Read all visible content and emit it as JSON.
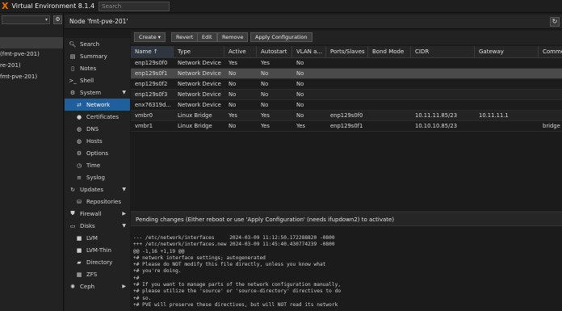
{
  "app": {
    "logo": "X",
    "title": "Virtual Environment 8.1.4"
  },
  "search": {
    "placeholder": "Search"
  },
  "tree": {
    "rows": [
      "",
      "(fmt-pve-201)",
      "re-201)",
      "fmt-pve-201)"
    ]
  },
  "node": {
    "title": "Node 'fmt-pve-201'"
  },
  "nav": {
    "items": [
      {
        "label": "Search",
        "icon": "search-icon",
        "glyph": "🔍︎"
      },
      {
        "label": "Summary",
        "icon": "book-icon",
        "glyph": "▤"
      },
      {
        "label": "Notes",
        "icon": "notes-icon",
        "glyph": "▯"
      },
      {
        "label": "Shell",
        "icon": "terminal-icon",
        "glyph": ">_"
      },
      {
        "label": "System",
        "icon": "gear-icon",
        "glyph": "⚙"
      },
      {
        "label": "Network",
        "icon": "network-icon",
        "glyph": "⇄"
      },
      {
        "label": "Certificates",
        "icon": "certificate-icon",
        "glyph": "●"
      },
      {
        "label": "DNS",
        "icon": "globe-icon",
        "glyph": "◍"
      },
      {
        "label": "Hosts",
        "icon": "hosts-icon",
        "glyph": "◍"
      },
      {
        "label": "Options",
        "icon": "options-icon",
        "glyph": "⚙"
      },
      {
        "label": "Time",
        "icon": "clock-icon",
        "glyph": "◷"
      },
      {
        "label": "Syslog",
        "icon": "list-icon",
        "glyph": "≡"
      },
      {
        "label": "Updates",
        "icon": "refresh-icon",
        "glyph": "↻"
      },
      {
        "label": "Repositories",
        "icon": "repository-icon",
        "glyph": "⛁"
      },
      {
        "label": "Firewall",
        "icon": "shield-icon",
        "glyph": "⛊"
      },
      {
        "label": "Disks",
        "icon": "disk-icon",
        "glyph": "▭"
      },
      {
        "label": "LVM",
        "icon": "square-icon",
        "glyph": "■"
      },
      {
        "label": "LVM-Thin",
        "icon": "square-icon",
        "glyph": "■"
      },
      {
        "label": "Directory",
        "icon": "folder-icon",
        "glyph": "▰"
      },
      {
        "label": "ZFS",
        "icon": "grid-icon",
        "glyph": "▦"
      },
      {
        "label": "Ceph",
        "icon": "ceph-icon",
        "glyph": "✺"
      }
    ]
  },
  "toolbar": {
    "create": "Create ▾",
    "revert": "Revert",
    "edit": "Edit",
    "remove": "Remove",
    "apply": "Apply Configuration"
  },
  "grid": {
    "columns": [
      "Name ↑",
      "Type",
      "Active",
      "Autostart",
      "VLAN a...",
      "Ports/Slaves",
      "Bond Mode",
      "CIDR",
      "Gateway",
      "Comment"
    ],
    "rows": [
      [
        "enp129s0f0",
        "Network Device",
        "Yes",
        "Yes",
        "No",
        "",
        "",
        "",
        "",
        ""
      ],
      [
        "enp129s0f1",
        "Network Device",
        "No",
        "No",
        "No",
        "",
        "",
        "",
        "",
        ""
      ],
      [
        "enp129s0f2",
        "Network Device",
        "No",
        "No",
        "No",
        "",
        "",
        "",
        "",
        ""
      ],
      [
        "enp129s0f3",
        "Network Device",
        "No",
        "No",
        "No",
        "",
        "",
        "",
        "",
        ""
      ],
      [
        "enx76319d...",
        "Network Device",
        "No",
        "No",
        "No",
        "",
        "",
        "",
        "",
        ""
      ],
      [
        "vmbr0",
        "Linux Bridge",
        "Yes",
        "Yes",
        "No",
        "enp129s0f0",
        "",
        "10.11.11.85/23",
        "10.11.11.1",
        ""
      ],
      [
        "vmbr1",
        "Linux Bridge",
        "No",
        "Yes",
        "Yes",
        "enp129s0f1",
        "",
        "10.10.10.85/23",
        "",
        "bridge f"
      ]
    ]
  },
  "pending": {
    "title": "Pending changes (Either reboot or use 'Apply Configuration' (needs ifupdown2) to activate)",
    "diff": "--- /etc/network/interfaces     2024-03-09 11:12:50.172288820 -0800\n+++ /etc/network/interfaces.new 2024-03-09 11:45:40.430774239 -0800\n@@ -1,16 +1,19 @@\n+# network interface settings; autogenerated\n+# Please do NOT modify this file directly, unless you know what\n+# you're doing.\n+#\n+# If you want to manage parts of the network configuration manually,\n+# please utilize the 'source' or 'source-directory' directives to do\n+# so.\n+# PVE will preserve these directives, but will NOT read its network"
  }
}
